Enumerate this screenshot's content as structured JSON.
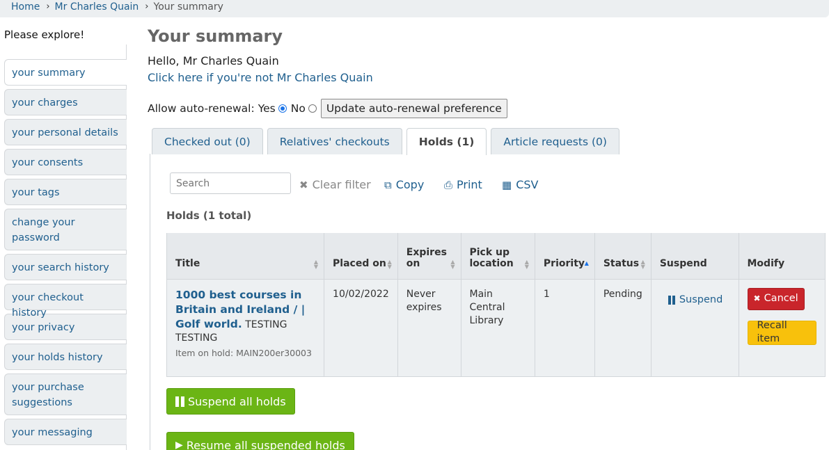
{
  "breadcrumb": {
    "home": "Home",
    "patron": "Mr Charles Quain",
    "current": "Your summary"
  },
  "sidebar": {
    "title": "Please explore!",
    "items": [
      {
        "label": "your summary",
        "active": true
      },
      {
        "label": "your charges"
      },
      {
        "label": "your personal details"
      },
      {
        "label": "your consents"
      },
      {
        "label": "your tags"
      },
      {
        "label": "change your password"
      },
      {
        "label": "your search history"
      },
      {
        "label": "your checkout history"
      },
      {
        "label": "your privacy"
      },
      {
        "label": "your holds history"
      },
      {
        "label": "your purchase suggestions"
      },
      {
        "label": "your messaging"
      }
    ]
  },
  "main": {
    "title": "Your summary",
    "hello": "Hello, Mr Charles Quain",
    "not_me": "Click here if you're not Mr Charles Quain",
    "autorenew": {
      "label": "Allow auto-renewal:",
      "yes": "Yes",
      "no": "No",
      "selected": "Yes",
      "button": "Update auto-renewal preference"
    },
    "tabs": [
      {
        "label": "Checked out (0)"
      },
      {
        "label": "Relatives' checkouts"
      },
      {
        "label": "Holds (1)",
        "active": true
      },
      {
        "label": "Article requests (0)"
      }
    ]
  },
  "toolbar": {
    "search_placeholder": "Search",
    "clear": "Clear filter",
    "copy": "Copy",
    "print": "Print",
    "csv": "CSV"
  },
  "holds": {
    "total_label": "Holds (1 total)",
    "columns": [
      "Title",
      "Placed on",
      "Expires on",
      "Pick up location",
      "Priority",
      "Status",
      "Suspend",
      "Modify"
    ],
    "rows": [
      {
        "title": "1000 best courses in Britain and Ireland / | Golf world.",
        "subtitle": "TESTING TESTING",
        "item_on_hold": "Item on hold: MAIN200er30003",
        "placed_on": "10/02/2022",
        "expires": "Never expires",
        "pickup": "Main Central Library",
        "priority": "1",
        "status": "Pending",
        "suspend": "Suspend",
        "cancel": "Cancel",
        "recall": "Recall item"
      }
    ],
    "suspend_all": "Suspend all holds",
    "resume_all": "Resume all suspended holds"
  },
  "colors": {
    "link": "#1f5f8e",
    "cancel": "#c9252b",
    "recall": "#f8c10c",
    "green": "#6bb515"
  }
}
